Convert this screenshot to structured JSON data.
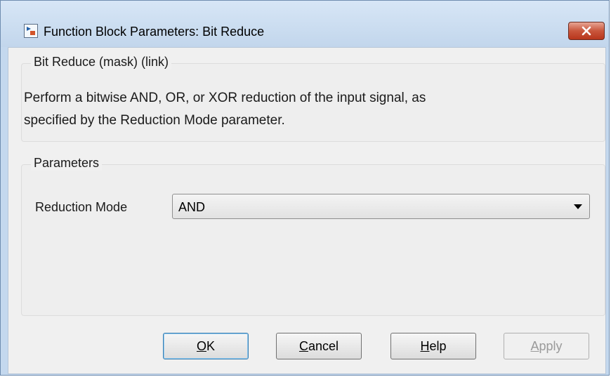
{
  "window": {
    "title": "Function Block Parameters: Bit Reduce"
  },
  "mask_group": {
    "label": "Bit Reduce (mask) (link)",
    "description_line1": "Perform a bitwise AND, OR, or XOR reduction of the input signal, as",
    "description_line2": "specified by the Reduction Mode parameter."
  },
  "parameters_group": {
    "label": "Parameters",
    "reduction_mode": {
      "label": "Reduction Mode",
      "value": "AND"
    }
  },
  "buttons": {
    "ok": {
      "mnemonic": "O",
      "rest": "K"
    },
    "cancel": {
      "mnemonic": "C",
      "rest": "ancel"
    },
    "help": {
      "mnemonic": "H",
      "rest": "elp"
    },
    "apply": {
      "mnemonic": "A",
      "rest": "pply"
    }
  },
  "icons": {
    "app": "simulink-block-icon",
    "close": "close-icon"
  },
  "colors": {
    "close_button": "#c9563c",
    "default_button_border": "#3c7fb1"
  }
}
